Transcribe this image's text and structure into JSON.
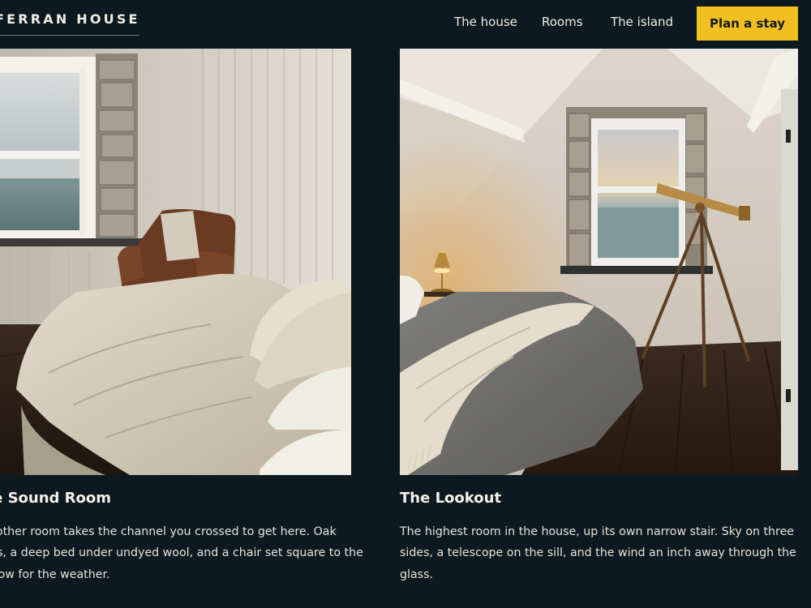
{
  "header": {
    "brand": "FERRAN HOUSE",
    "nav": [
      {
        "label": "The house"
      },
      {
        "label": "Rooms"
      },
      {
        "label": "The island"
      }
    ],
    "cta_label": "Plan a stay"
  },
  "rooms": [
    {
      "title": "The Sound Room",
      "description_lines": [
        "The other room takes the channel you crossed to get here. Oak",
        "floors, a deep bed under undyed wool, and a chair set square to the",
        "window for the weather."
      ],
      "photo": "bedroom with sea view window, leather armchair and cream bedding"
    },
    {
      "title": "The Lookout",
      "description_lines": [
        "The highest room in the house, up its own narrow stair. Sky on three",
        "sides, a telescope on the sill, and the wind an inch away through the",
        "glass."
      ],
      "photo": "attic bedroom with gable window, brass telescope on tripod and lit lamp"
    }
  ],
  "colors": {
    "background": "#0c1920",
    "accent": "#f2bf21",
    "text": "#f1ede4"
  }
}
